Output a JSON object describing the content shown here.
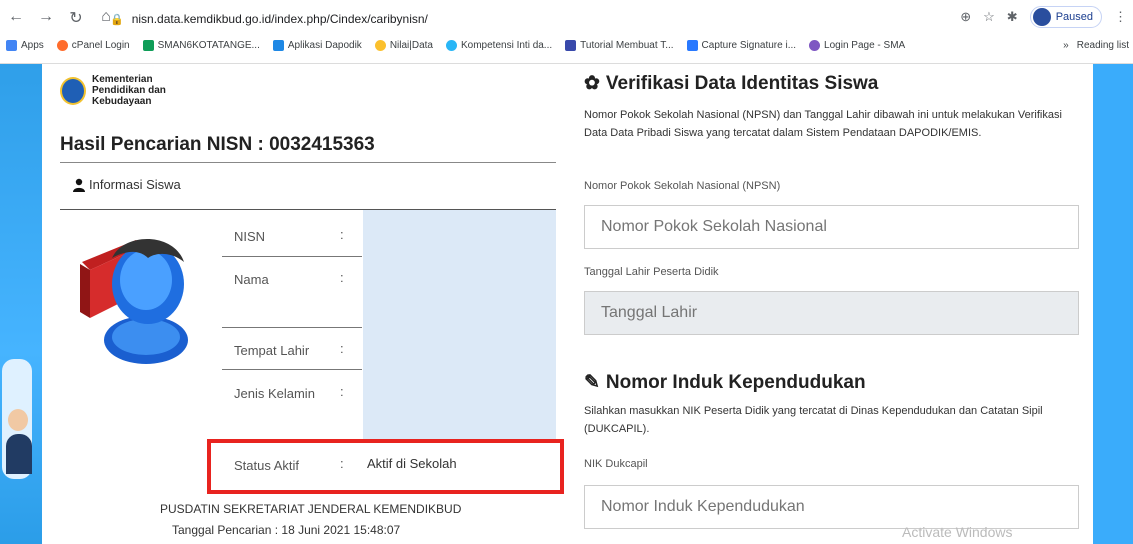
{
  "browser": {
    "url": "nisn.data.kemdikbud.go.id/index.php/Cindex/caribynisn/",
    "paused_label": "Paused",
    "bookmarks": [
      "Apps",
      "cPanel Login",
      "SMAN6KOTATANGE...",
      "Aplikasi Dapodik",
      "Nilai|Data",
      "Kompetensi Inti da...",
      "Tutorial Membuat T...",
      "Capture Signature i...",
      "Login Page - SMA"
    ],
    "more_label": "»",
    "reading_list": "Reading list"
  },
  "header": {
    "org_line1": "Kementerian",
    "org_line2": "Pendidikan dan",
    "org_line3": "Kebudayaan"
  },
  "result": {
    "title": "Hasil Pencarian NISN : 0032415363",
    "info_heading": "Informasi Siswa",
    "rows": [
      {
        "key": "NISN",
        "colon": ":",
        "value": ""
      },
      {
        "key": "Nama",
        "colon": ":",
        "value": ""
      },
      {
        "key": "Tempat Lahir",
        "colon": ":",
        "value": ""
      },
      {
        "key": "Jenis Kelamin",
        "colon": ":",
        "value": ""
      },
      {
        "key": "Status Aktif",
        "colon": ":",
        "value": "Aktif di Sekolah"
      }
    ],
    "footer_org": "PUSDATIN SEKRETARIAT JENDERAL KEMENDIKBUD",
    "footer_date": "Tanggal Pencarian : 18 Juni 2021 15:48:07"
  },
  "verify": {
    "title": "Verifikasi Data Identitas Siswa",
    "desc_p1": "Nomor Pokok Sekolah Nasional (NPSN) dan Tanggal Lahir dibawah ini untuk melakukan Verifikasi Data Data Pribadi Siswa yang tercatat dalam Sistem Pendataan DAPODIK/EMIS.",
    "npsn_label": "Nomor Pokok Sekolah Nasional (NPSN)",
    "npsn_placeholder": "Nomor Pokok Sekolah Nasional",
    "dob_label": "Tanggal Lahir Peserta Didik",
    "dob_placeholder": "Tanggal Lahir"
  },
  "nik": {
    "title": "Nomor Induk Kependudukan",
    "desc": "Silahkan masukkan NIK Peserta Didik yang tercatat di Dinas Kependudukan dan Catatan Sipil (DUKCAPIL).",
    "label": "NIK Dukcapil",
    "placeholder": "Nomor Induk Kependudukan"
  },
  "watermark": "Activate Windows",
  "colors": {
    "highlight": "#e8231f",
    "accent_blue": "#3aacfb"
  }
}
